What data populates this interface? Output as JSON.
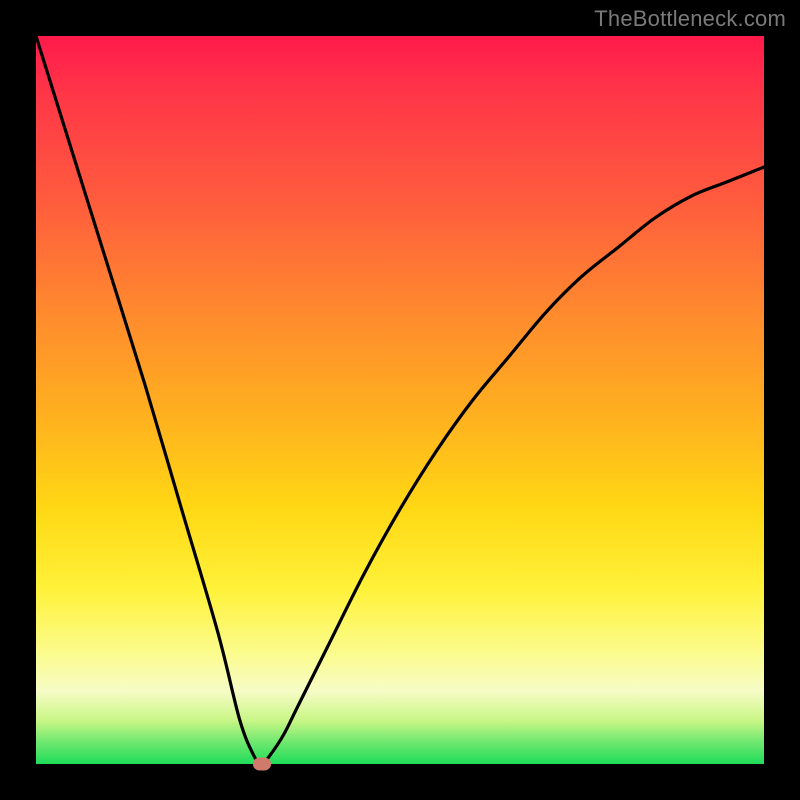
{
  "watermark": "TheBottleneck.com",
  "chart_data": {
    "type": "line",
    "title": "",
    "xlabel": "",
    "ylabel": "",
    "xlim": [
      0,
      100
    ],
    "ylim": [
      0,
      100
    ],
    "grid": false,
    "legend": false,
    "series": [
      {
        "name": "bottleneck-curve",
        "x": [
          0,
          5,
          10,
          15,
          20,
          25,
          28,
          30,
          31,
          32,
          34,
          36,
          40,
          45,
          50,
          55,
          60,
          65,
          70,
          75,
          80,
          85,
          90,
          95,
          100
        ],
        "values": [
          100,
          84,
          68,
          52,
          35,
          18,
          6,
          1,
          0,
          1,
          4,
          8,
          16,
          26,
          35,
          43,
          50,
          56,
          62,
          67,
          71,
          75,
          78,
          80,
          82
        ]
      }
    ],
    "annotations": [
      {
        "name": "min-marker",
        "x": 31,
        "y": 0
      }
    ],
    "background_gradient": {
      "top": "#ff1a4b",
      "upper_mid": "#ff8a2e",
      "mid": "#ffd814",
      "lower_mid": "#f6fcc6",
      "bottom": "#1fdc5a"
    }
  }
}
